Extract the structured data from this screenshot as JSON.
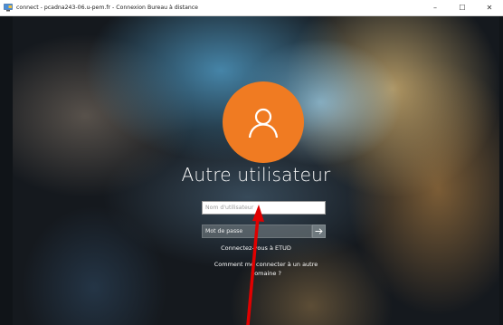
{
  "window": {
    "title": "connect - pcadna243-06.u-pem.fr - Connexion Bureau à distance",
    "minimize": "–",
    "maximize": "☐",
    "close": "✕"
  },
  "login": {
    "user_title": "Autre utilisateur",
    "username_placeholder": "Nom d'utilisateur",
    "username_value": "",
    "password_placeholder": "Mot de passe",
    "domain_text": "Connectez-vous à ETUD",
    "other_domain_link": "Comment me connecter à un autre domaine ?"
  },
  "icons": {
    "avatar": "user-icon",
    "submit": "arrow-right-icon",
    "annotation": "red-arrow-annotation"
  },
  "colors": {
    "avatar_bg": "#f07b22",
    "annotation": "#e00000"
  }
}
